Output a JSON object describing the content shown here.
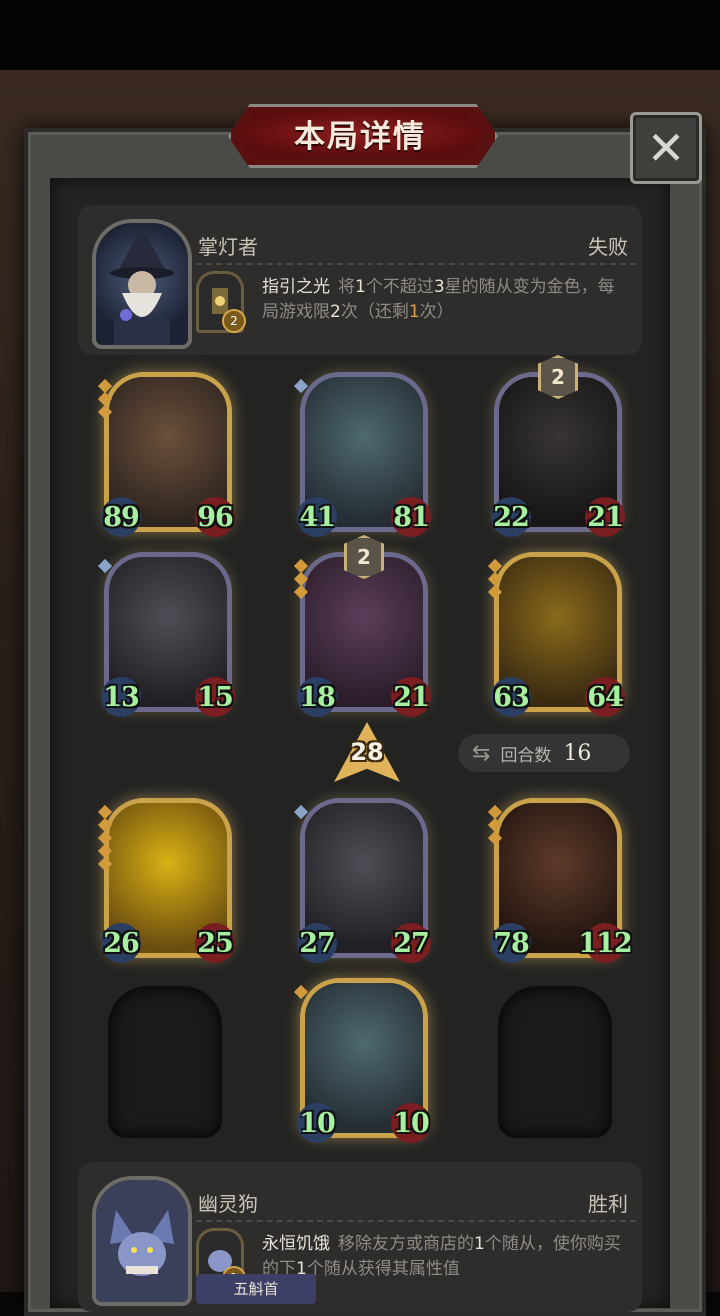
{
  "title": "本局详情",
  "close_icon": "close-x-icon",
  "heroes": [
    {
      "name": "掌灯者",
      "result": "失败",
      "skill_name": "指引之光",
      "skill_desc_parts": [
        "将",
        "1",
        "个不超过",
        "3",
        "星的随从变为金色，每局游戏限",
        "2",
        "次（还剩",
        "1",
        "次）"
      ],
      "skill_charges": "2"
    },
    {
      "name": "幽灵狗",
      "result": "胜利",
      "skill_name": "永恒饥饿",
      "skill_desc_parts": [
        "移除友方或商店的",
        "1",
        "个随从，使你购买的下",
        "1",
        "个随从获得其属性值"
      ],
      "skill_charges": "1",
      "tag": "五斛首"
    }
  ],
  "board1": [
    {
      "atk": "89",
      "hp": "96",
      "gold": true,
      "level": "",
      "pips": 3,
      "pip_color": "gold"
    },
    {
      "atk": "41",
      "hp": "81",
      "gold": false,
      "level": "",
      "pips": 1,
      "pip_color": "blue"
    },
    {
      "atk": "22",
      "hp": "21",
      "gold": false,
      "level": "2",
      "pips": 0,
      "pip_color": "gold"
    },
    {
      "atk": "13",
      "hp": "15",
      "gold": false,
      "level": "",
      "pips": 1,
      "pip_color": "blue"
    },
    {
      "atk": "18",
      "hp": "21",
      "gold": false,
      "level": "2",
      "pips": 3,
      "pip_color": "gold"
    },
    {
      "atk": "63",
      "hp": "64",
      "gold": true,
      "level": "",
      "pips": 3,
      "pip_color": "gold"
    }
  ],
  "tavern_tier": "28",
  "round_label": "回合数",
  "round_value": "16",
  "board2": [
    {
      "atk": "26",
      "hp": "25",
      "gold": true,
      "level": "",
      "pips": 5,
      "pip_color": "gold"
    },
    {
      "atk": "27",
      "hp": "27",
      "gold": false,
      "level": "",
      "pips": 1,
      "pip_color": "blue"
    },
    {
      "atk": "78",
      "hp": "112",
      "gold": true,
      "level": "",
      "pips": 3,
      "pip_color": "gold"
    },
    {
      "atk": "10",
      "hp": "10",
      "gold": true,
      "level": "",
      "pips": 1,
      "pip_color": "gold"
    }
  ]
}
